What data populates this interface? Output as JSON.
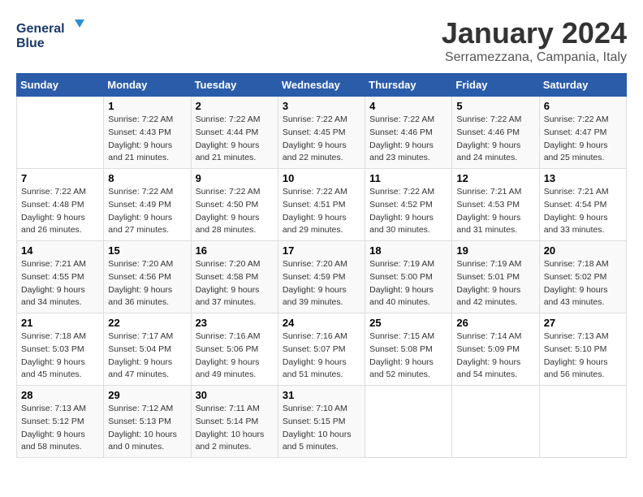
{
  "header": {
    "logo_line1": "General",
    "logo_line2": "Blue",
    "month": "January 2024",
    "location": "Serramezzana, Campania, Italy"
  },
  "columns": [
    "Sunday",
    "Monday",
    "Tuesday",
    "Wednesday",
    "Thursday",
    "Friday",
    "Saturday"
  ],
  "weeks": [
    [
      {
        "day": "",
        "info": ""
      },
      {
        "day": "1",
        "info": "Sunrise: 7:22 AM\nSunset: 4:43 PM\nDaylight: 9 hours\nand 21 minutes."
      },
      {
        "day": "2",
        "info": "Sunrise: 7:22 AM\nSunset: 4:44 PM\nDaylight: 9 hours\nand 21 minutes."
      },
      {
        "day": "3",
        "info": "Sunrise: 7:22 AM\nSunset: 4:45 PM\nDaylight: 9 hours\nand 22 minutes."
      },
      {
        "day": "4",
        "info": "Sunrise: 7:22 AM\nSunset: 4:46 PM\nDaylight: 9 hours\nand 23 minutes."
      },
      {
        "day": "5",
        "info": "Sunrise: 7:22 AM\nSunset: 4:46 PM\nDaylight: 9 hours\nand 24 minutes."
      },
      {
        "day": "6",
        "info": "Sunrise: 7:22 AM\nSunset: 4:47 PM\nDaylight: 9 hours\nand 25 minutes."
      }
    ],
    [
      {
        "day": "7",
        "info": "Sunrise: 7:22 AM\nSunset: 4:48 PM\nDaylight: 9 hours\nand 26 minutes."
      },
      {
        "day": "8",
        "info": "Sunrise: 7:22 AM\nSunset: 4:49 PM\nDaylight: 9 hours\nand 27 minutes."
      },
      {
        "day": "9",
        "info": "Sunrise: 7:22 AM\nSunset: 4:50 PM\nDaylight: 9 hours\nand 28 minutes."
      },
      {
        "day": "10",
        "info": "Sunrise: 7:22 AM\nSunset: 4:51 PM\nDaylight: 9 hours\nand 29 minutes."
      },
      {
        "day": "11",
        "info": "Sunrise: 7:22 AM\nSunset: 4:52 PM\nDaylight: 9 hours\nand 30 minutes."
      },
      {
        "day": "12",
        "info": "Sunrise: 7:21 AM\nSunset: 4:53 PM\nDaylight: 9 hours\nand 31 minutes."
      },
      {
        "day": "13",
        "info": "Sunrise: 7:21 AM\nSunset: 4:54 PM\nDaylight: 9 hours\nand 33 minutes."
      }
    ],
    [
      {
        "day": "14",
        "info": "Sunrise: 7:21 AM\nSunset: 4:55 PM\nDaylight: 9 hours\nand 34 minutes."
      },
      {
        "day": "15",
        "info": "Sunrise: 7:20 AM\nSunset: 4:56 PM\nDaylight: 9 hours\nand 36 minutes."
      },
      {
        "day": "16",
        "info": "Sunrise: 7:20 AM\nSunset: 4:58 PM\nDaylight: 9 hours\nand 37 minutes."
      },
      {
        "day": "17",
        "info": "Sunrise: 7:20 AM\nSunset: 4:59 PM\nDaylight: 9 hours\nand 39 minutes."
      },
      {
        "day": "18",
        "info": "Sunrise: 7:19 AM\nSunset: 5:00 PM\nDaylight: 9 hours\nand 40 minutes."
      },
      {
        "day": "19",
        "info": "Sunrise: 7:19 AM\nSunset: 5:01 PM\nDaylight: 9 hours\nand 42 minutes."
      },
      {
        "day": "20",
        "info": "Sunrise: 7:18 AM\nSunset: 5:02 PM\nDaylight: 9 hours\nand 43 minutes."
      }
    ],
    [
      {
        "day": "21",
        "info": "Sunrise: 7:18 AM\nSunset: 5:03 PM\nDaylight: 9 hours\nand 45 minutes."
      },
      {
        "day": "22",
        "info": "Sunrise: 7:17 AM\nSunset: 5:04 PM\nDaylight: 9 hours\nand 47 minutes."
      },
      {
        "day": "23",
        "info": "Sunrise: 7:16 AM\nSunset: 5:06 PM\nDaylight: 9 hours\nand 49 minutes."
      },
      {
        "day": "24",
        "info": "Sunrise: 7:16 AM\nSunset: 5:07 PM\nDaylight: 9 hours\nand 51 minutes."
      },
      {
        "day": "25",
        "info": "Sunrise: 7:15 AM\nSunset: 5:08 PM\nDaylight: 9 hours\nand 52 minutes."
      },
      {
        "day": "26",
        "info": "Sunrise: 7:14 AM\nSunset: 5:09 PM\nDaylight: 9 hours\nand 54 minutes."
      },
      {
        "day": "27",
        "info": "Sunrise: 7:13 AM\nSunset: 5:10 PM\nDaylight: 9 hours\nand 56 minutes."
      }
    ],
    [
      {
        "day": "28",
        "info": "Sunrise: 7:13 AM\nSunset: 5:12 PM\nDaylight: 9 hours\nand 58 minutes."
      },
      {
        "day": "29",
        "info": "Sunrise: 7:12 AM\nSunset: 5:13 PM\nDaylight: 10 hours\nand 0 minutes."
      },
      {
        "day": "30",
        "info": "Sunrise: 7:11 AM\nSunset: 5:14 PM\nDaylight: 10 hours\nand 2 minutes."
      },
      {
        "day": "31",
        "info": "Sunrise: 7:10 AM\nSunset: 5:15 PM\nDaylight: 10 hours\nand 5 minutes."
      },
      {
        "day": "",
        "info": ""
      },
      {
        "day": "",
        "info": ""
      },
      {
        "day": "",
        "info": ""
      }
    ]
  ]
}
